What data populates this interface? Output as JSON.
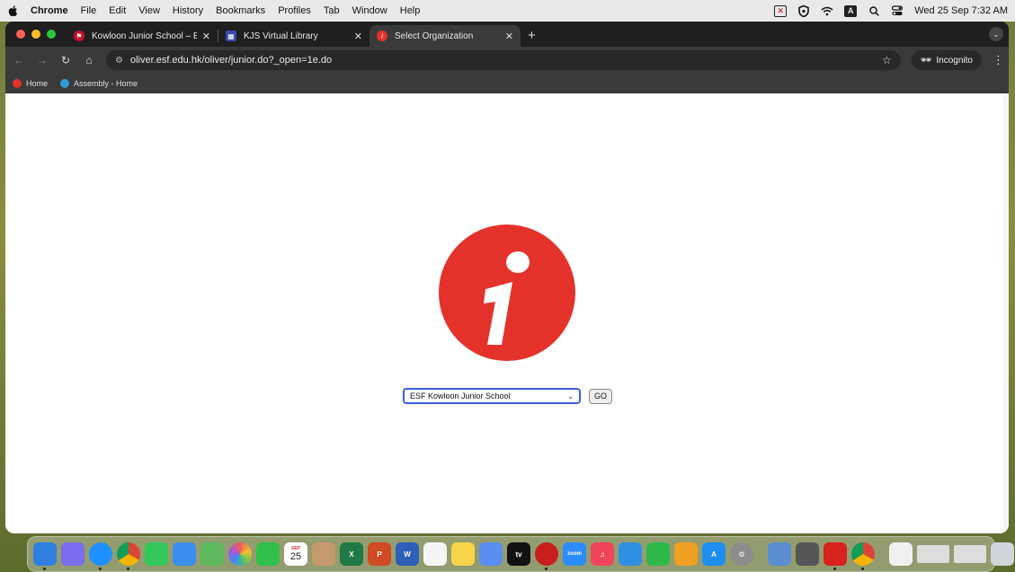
{
  "menubar": {
    "app_name": "Chrome",
    "menus": [
      "File",
      "Edit",
      "View",
      "History",
      "Bookmarks",
      "Profiles",
      "Tab",
      "Window",
      "Help"
    ],
    "datetime": "Wed 25 Sep  7:32 AM"
  },
  "tabs": [
    {
      "label": "Kowloon Junior School – ESF",
      "favicon_color": "#c8102e"
    },
    {
      "label": "KJS Virtual Library",
      "favicon_color": "#3949ab"
    },
    {
      "label": "Select Organization",
      "favicon_color": "#e4322b",
      "active": true
    }
  ],
  "toolbar": {
    "url": "oliver.esf.edu.hk/oliver/junior.do?_open=1e.do",
    "incognito_label": "Incognito"
  },
  "bookmarks": [
    {
      "label": "Home",
      "icon_color": "#e4322b"
    },
    {
      "label": "Assembly - Home",
      "icon_color": "#2e9bd6"
    }
  ],
  "page": {
    "logo_color": "#e4322b",
    "select_value": "ESF Kowloon Junior School",
    "go_label": "GO"
  },
  "dock": {
    "icons": [
      {
        "name": "finder-icon",
        "color": "#2f80e0"
      },
      {
        "name": "launchpad-icon",
        "color": "#7a6df0"
      },
      {
        "name": "safari-icon",
        "color": "#1e90ff"
      },
      {
        "name": "chrome-icon",
        "color": "#e8b02a"
      },
      {
        "name": "messages-icon",
        "color": "#34c759"
      },
      {
        "name": "mail-icon",
        "color": "#3a8ef0"
      },
      {
        "name": "maps-icon",
        "color": "#5cb85c"
      },
      {
        "name": "photos-icon",
        "color": "#f0a030"
      },
      {
        "name": "facetime-icon",
        "color": "#2fbf4a"
      },
      {
        "name": "calendar-icon",
        "color": "#ffffff"
      },
      {
        "name": "contacts-icon",
        "color": "#c49a6c"
      },
      {
        "name": "excel-icon",
        "color": "#1f7a45"
      },
      {
        "name": "powerpoint-icon",
        "color": "#d04a24"
      },
      {
        "name": "word-icon",
        "color": "#2b5fb8"
      },
      {
        "name": "reminders-icon",
        "color": "#f5f5f5"
      },
      {
        "name": "notes-icon",
        "color": "#f7d34a"
      },
      {
        "name": "freeform-icon",
        "color": "#5a8ef0"
      },
      {
        "name": "appletv-icon",
        "color": "#111111"
      },
      {
        "name": "photobooth-icon",
        "color": "#c81e1e"
      },
      {
        "name": "zoom-icon",
        "color": "#2d8cff"
      },
      {
        "name": "music-icon",
        "color": "#f0455a"
      },
      {
        "name": "keynote-icon",
        "color": "#2f8fe0"
      },
      {
        "name": "numbers-icon",
        "color": "#2fb84a"
      },
      {
        "name": "pages-icon",
        "color": "#f0a020"
      },
      {
        "name": "appstore-icon",
        "color": "#1e8ef0"
      },
      {
        "name": "systemsettings-icon",
        "color": "#8c8c8c"
      },
      {
        "name": "preview-icon",
        "color": "#5a8ed0"
      },
      {
        "name": "printer-icon",
        "color": "#555555"
      },
      {
        "name": "acrobat-icon",
        "color": "#d8231e"
      },
      {
        "name": "chrome-icon-2",
        "color": "#e8b02a"
      },
      {
        "name": "downloads-icon",
        "color": "#f0f0f0"
      },
      {
        "name": "window-thumb-icon",
        "color": "#dddddd"
      },
      {
        "name": "window-thumb-icon-2",
        "color": "#dddddd"
      },
      {
        "name": "trash-icon",
        "color": "#cfd6dc"
      }
    ],
    "calendar_day": "25",
    "calendar_month": "SEP",
    "appletv_label": "tv",
    "zoom_label": "zoom"
  }
}
